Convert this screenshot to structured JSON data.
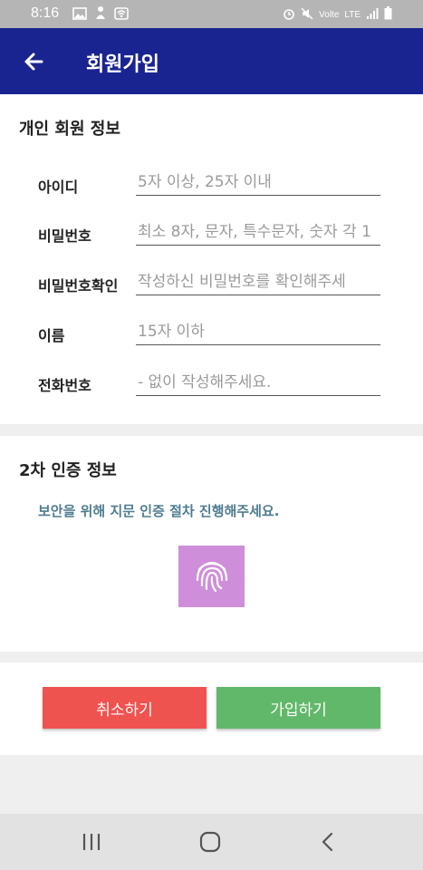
{
  "status_bar": {
    "time": "8:16",
    "network": "LTE",
    "carrier_label": "Volte",
    "icons": [
      "image-icon",
      "notification-icon",
      "wifi-hotspot-icon",
      "alarm-icon",
      "mute-icon",
      "signal-icon",
      "battery-icon"
    ]
  },
  "header": {
    "title": "회원가입",
    "back_icon": "arrow-left-icon"
  },
  "personal_info": {
    "section_title": "개인 회원 정보",
    "fields": [
      {
        "label": "아이디",
        "value": "",
        "placeholder": "5자 이상, 25자 이내"
      },
      {
        "label": "비밀번호",
        "value": "",
        "placeholder": "최소 8자, 문자, 특수문자, 숫자 각 1"
      },
      {
        "label": "비밀번호확인",
        "value": "",
        "placeholder": "작성하신 비밀번호를 확인해주세"
      },
      {
        "label": "이름",
        "value": "",
        "placeholder": "15자 이하"
      },
      {
        "label": "전화번호",
        "value": "",
        "placeholder": "- 없이 작성해주세요."
      }
    ]
  },
  "second_auth": {
    "section_title": "2차 인증 정보",
    "notice": "보안을 위해 지문 인증 절차 진행해주세요.",
    "fingerprint_icon": "fingerprint-icon"
  },
  "actions": {
    "cancel_label": "취소하기",
    "join_label": "가입하기"
  },
  "colors": {
    "app_bar": "#1a2490",
    "cancel": "#ef5350",
    "join": "#62b86a",
    "fingerprint": "#cf8ed9",
    "notice": "#4f7c91"
  },
  "nav_bar": {
    "icons": [
      "recent-apps-icon",
      "home-icon",
      "back-nav-icon"
    ]
  }
}
